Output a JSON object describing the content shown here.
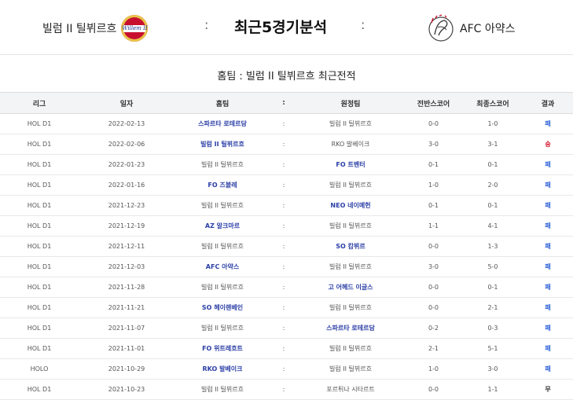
{
  "header": {
    "home_team": "빌럼 II 틸뷔르흐",
    "home_logo_text": "Willem II",
    "separator": ":",
    "title": "최근5경기분석",
    "away_team": "AFC 아약스"
  },
  "subtitle": "홈팀 : 빌럼 II 틸뷔르흐 최근전적",
  "table": {
    "columns": [
      "리그",
      "일자",
      "홈팀",
      ":",
      "원정팀",
      "전반스코어",
      "최종스코어",
      "결과"
    ],
    "rows": [
      {
        "league": "HOL D1",
        "date": "2022-02-13",
        "home": "스파르타 로테르담",
        "sep": ":",
        "away": "빌럼 II 틸뷔르흐",
        "half": "0-0",
        "final": "1-0",
        "result": "패",
        "hl": "home",
        "rtype": "lose"
      },
      {
        "league": "HOL D1",
        "date": "2022-02-06",
        "home": "빌럼 II 틸뷔르흐",
        "sep": ":",
        "away": "RKO 발베이크",
        "half": "3-0",
        "final": "3-1",
        "result": "승",
        "hl": "home",
        "rtype": "win"
      },
      {
        "league": "HOL D1",
        "date": "2022-01-23",
        "home": "빌럼 II 틸뷔르흐",
        "sep": ":",
        "away": "FO 트벤터",
        "half": "0-1",
        "final": "0-1",
        "result": "패",
        "hl": "away",
        "rtype": "lose"
      },
      {
        "league": "HOL D1",
        "date": "2022-01-16",
        "home": "FO 즈볼레",
        "sep": ":",
        "away": "빌럼 II 틸뷔르흐",
        "half": "1-0",
        "final": "2-0",
        "result": "패",
        "hl": "home",
        "rtype": "lose"
      },
      {
        "league": "HOL D1",
        "date": "2021-12-23",
        "home": "빌럼 II 틸뷔르흐",
        "sep": ":",
        "away": "NEO 네이메헌",
        "half": "0-1",
        "final": "0-1",
        "result": "패",
        "hl": "away",
        "rtype": "lose"
      },
      {
        "league": "HOL D1",
        "date": "2021-12-19",
        "home": "AZ 알크마르",
        "sep": ":",
        "away": "빌럼 II 틸뷔르흐",
        "half": "1-1",
        "final": "4-1",
        "result": "패",
        "hl": "home",
        "rtype": "lose"
      },
      {
        "league": "HOL D1",
        "date": "2021-12-11",
        "home": "빌럼 II 틸뷔르흐",
        "sep": ":",
        "away": "SO 캄뷔르",
        "half": "0-0",
        "final": "1-3",
        "result": "패",
        "hl": "away",
        "rtype": "lose"
      },
      {
        "league": "HOL D1",
        "date": "2021-12-03",
        "home": "AFC 아약스",
        "sep": ":",
        "away": "빌럼 II 틸뷔르흐",
        "half": "3-0",
        "final": "5-0",
        "result": "패",
        "hl": "home",
        "rtype": "lose"
      },
      {
        "league": "HOL D1",
        "date": "2021-11-28",
        "home": "빌럼 II 틸뷔르흐",
        "sep": ":",
        "away": "고 어헤드 이글스",
        "half": "0-0",
        "final": "0-1",
        "result": "패",
        "hl": "away",
        "rtype": "lose"
      },
      {
        "league": "HOL D1",
        "date": "2021-11-21",
        "home": "SO 헤이렌베인",
        "sep": ":",
        "away": "빌럼 II 틸뷔르흐",
        "half": "0-0",
        "final": "2-1",
        "result": "패",
        "hl": "home",
        "rtype": "lose"
      },
      {
        "league": "HOL D1",
        "date": "2021-11-07",
        "home": "빌럼 II 틸뷔르흐",
        "sep": ":",
        "away": "스파르타 로테르담",
        "half": "0-2",
        "final": "0-3",
        "result": "패",
        "hl": "away",
        "rtype": "lose"
      },
      {
        "league": "HOL D1",
        "date": "2021-11-01",
        "home": "FO 위트레흐트",
        "sep": ":",
        "away": "빌럼 II 틸뷔르흐",
        "half": "2-1",
        "final": "5-1",
        "result": "패",
        "hl": "home",
        "rtype": "lose"
      },
      {
        "league": "HOLO",
        "date": "2021-10-29",
        "home": "RKO 발베이크",
        "sep": ":",
        "away": "빌럼 II 틸뷔르흐",
        "half": "1-0",
        "final": "3-0",
        "result": "패",
        "hl": "home",
        "rtype": "lose"
      },
      {
        "league": "HOL D1",
        "date": "2021-10-23",
        "home": "빌럼 II 틸뷔르흐",
        "sep": ":",
        "away": "포르튀나 시타르트",
        "half": "0-0",
        "final": "1-1",
        "result": "무",
        "hl": "none",
        "rtype": "draw"
      }
    ]
  },
  "colors": {
    "highlight_team": "#2b3fa6",
    "lose": "#2b5fd8",
    "win": "#d0021b",
    "header_bg": "#f3f4f6"
  }
}
